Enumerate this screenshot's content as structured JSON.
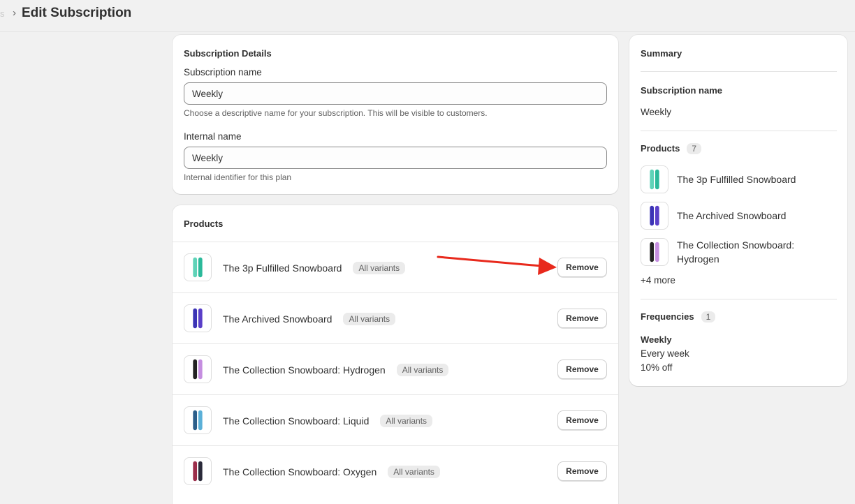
{
  "header": {
    "crumb_faded": "s",
    "separator": "›",
    "title": "Edit Subscription"
  },
  "details": {
    "title": "Subscription Details",
    "name_label": "Subscription name",
    "name_value": "Weekly",
    "name_help": "Choose a descriptive name for your subscription. This will be visible to customers.",
    "internal_label": "Internal name",
    "internal_value": "Weekly",
    "internal_help": "Internal identifier for this plan"
  },
  "products": {
    "title": "Products",
    "remove_label": "Remove",
    "items": [
      {
        "name": "The 3p Fulfilled Snowboard",
        "badge": "All variants",
        "icon": "snowboard-teal-icon",
        "colors": [
          "#5fd3b8",
          "#2bb99a"
        ]
      },
      {
        "name": "The Archived Snowboard",
        "badge": "All variants",
        "icon": "snowboard-purple-icon",
        "colors": [
          "#3b33b5",
          "#5a3fc8"
        ]
      },
      {
        "name": "The Collection Snowboard: Hydrogen",
        "badge": "All variants",
        "icon": "snowboard-hydrogen-icon",
        "colors": [
          "#222222",
          "#c58ee0"
        ]
      },
      {
        "name": "The Collection Snowboard: Liquid",
        "badge": "All variants",
        "icon": "snowboard-liquid-icon",
        "colors": [
          "#2a5e8a",
          "#5bb0d8"
        ]
      },
      {
        "name": "The Collection Snowboard: Oxygen",
        "badge": "All variants",
        "icon": "snowboard-oxygen-icon",
        "colors": [
          "#9b2d4a",
          "#2a2a3a"
        ]
      }
    ]
  },
  "summary": {
    "title": "Summary",
    "name_label": "Subscription name",
    "name_value": "Weekly",
    "products_label": "Products",
    "products_count": "7",
    "products": [
      {
        "name": "The 3p Fulfilled Snowboard"
      },
      {
        "name": "The Archived Snowboard"
      },
      {
        "name": "The Collection Snowboard: Hydrogen"
      }
    ],
    "more": "+4 more",
    "frequencies_label": "Frequencies",
    "frequencies_count": "1",
    "frequency_name": "Weekly",
    "frequency_interval": "Every week",
    "frequency_discount": "10% off"
  },
  "colors": {
    "background": "#f1f1f1",
    "card": "#ffffff",
    "annotation_arrow": "#e8291c"
  }
}
